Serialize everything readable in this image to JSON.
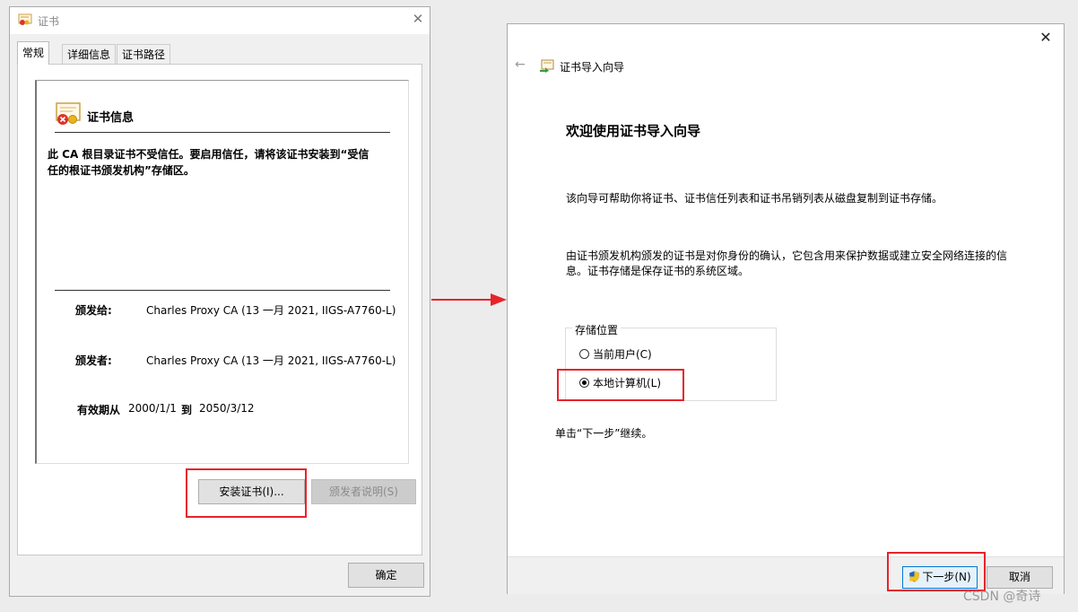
{
  "left_window": {
    "title": "证书",
    "close_glyph": "✕",
    "tabs": [
      "常规",
      "详细信息",
      "证书路径"
    ],
    "cert_info_title": "证书信息",
    "warning": "此 CA 根目录证书不受信任。要启用信任，请将该证书安装到“受信任的根证书颁发机构”存储区。",
    "issued_to_label": "颁发给:",
    "issued_to_value": "Charles Proxy CA (13 一月 2021, IIGS-A7760-L)",
    "issued_by_label": "颁发者:",
    "issued_by_value": "Charles Proxy CA (13 一月 2021, IIGS-A7760-L)",
    "valid_from_label": "有效期从",
    "valid_from_value": "2000/1/1",
    "valid_to_label": "到",
    "valid_to_value": "2050/3/12",
    "install_button": "安装证书(I)...",
    "issuer_statement_button": "颁发者说明(S)",
    "ok_button": "确定"
  },
  "right_window": {
    "close_glyph": "✕",
    "back_glyph": "←",
    "wizard_title": "证书导入向导",
    "heading": "欢迎使用证书导入向导",
    "intro": "该向导可帮助你将证书、证书信任列表和证书吊销列表从磁盘复制到证书存储。",
    "description": "由证书颁发机构颁发的证书是对你身份的确认，它包含用来保护数据或建立安全网络连接的信息。证书存储是保存证书的系统区域。",
    "store_location_legend": "存储位置",
    "options": {
      "current_user": "当前用户(C)",
      "local_machine": "本地计算机(L)",
      "selected": "local_machine"
    },
    "continue_hint": "单击“下一步”继续。",
    "next_button": "下一步(N)",
    "cancel_button": "取消"
  },
  "accent_colors": {
    "highlight": "#e8232a",
    "focus": "#0078d7"
  },
  "watermark": "CSDN @奇诗"
}
